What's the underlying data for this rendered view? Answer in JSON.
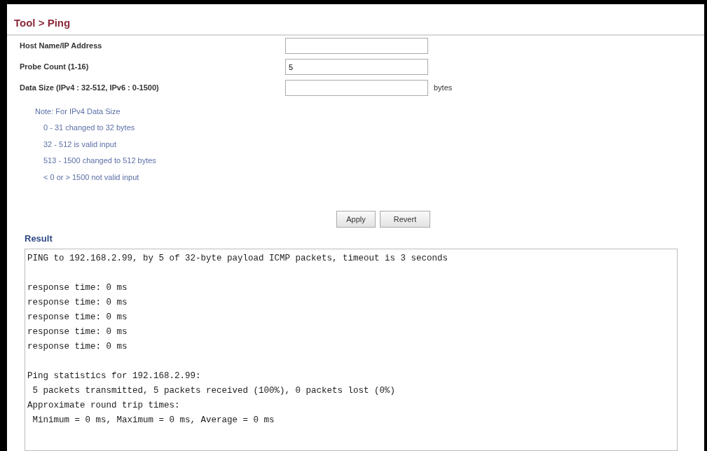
{
  "title": "Tool > Ping",
  "fields": [
    {
      "label": "Host Name/IP Address"
    },
    {
      "label": "Probe Count (1-16)",
      "value": "5"
    },
    {
      "label": "Data Size (IPv4 : 32-512, IPv6 : 0-1500)",
      "unit": "bytes"
    }
  ],
  "note": {
    "heading": "Note: For IPv4 Data Size",
    "items": [
      "0 - 31 changed to 32 bytes",
      "32 - 512 is valid input",
      "513 - 1500 changed to 512 bytes",
      "< 0 or > 1500 not valid input"
    ]
  },
  "buttons": [
    "Apply",
    "Revert"
  ],
  "result": {
    "heading": "Result",
    "blocks": [
      [
        "PING to 192.168.2.99, by 5 of 32-byte payload ICMP packets, timeout is 3 seconds"
      ],
      [
        "response time: 0 ms",
        "response time: 0 ms",
        "response time: 0 ms",
        "response time: 0 ms",
        "response time: 0 ms"
      ],
      [
        "Ping statistics for 192.168.2.99:",
        " 5 packets transmitted, 5 packets received (100%), 0 packets lost (0%)",
        "Approximate round trip times:",
        " Minimum = 0 ms, Maximum = 0 ms, Average = 0 ms"
      ]
    ]
  }
}
